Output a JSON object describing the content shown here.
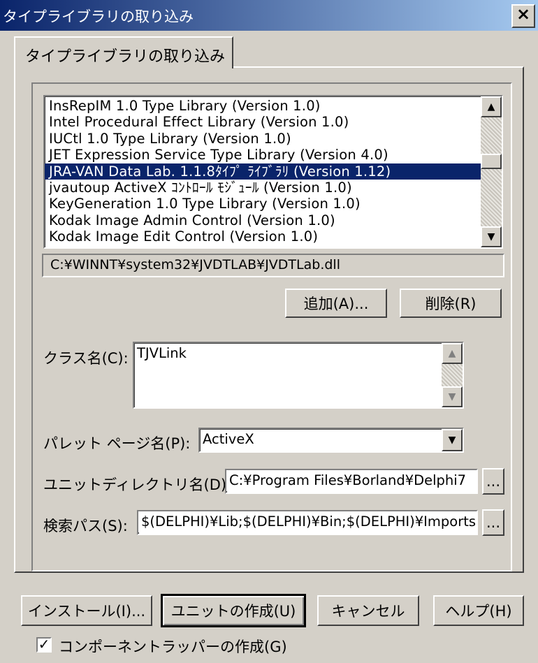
{
  "window": {
    "title": "タイプライブラリの取り込み",
    "close_glyph": "×"
  },
  "tab": {
    "label": "タイプライブラリの取り込み"
  },
  "library_list": {
    "items": [
      "InsRepIM 1.0 Type Library (Version 1.0)",
      "Intel Procedural Effect Library (Version 1.0)",
      "IUCtl 1.0 Type Library (Version 1.0)",
      "JET Expression Service Type Library (Version 4.0)",
      "JRA-VAN Data Lab. 1.1.8ﾀｲﾌﾟ ﾗｲﾌﾞﾗﾘ (Version 1.12)",
      "jvautoup ActiveX ｺﾝﾄﾛｰﾙ ﾓｼﾞｭｰﾙ (Version 1.0)",
      "KeyGeneration 1.0 Type Library (Version 1.0)",
      "Kodak Image Admin Control (Version 1.0)",
      "Kodak Image Edit Control (Version 1.0)"
    ],
    "selected_index": 4
  },
  "path": {
    "value": "C:¥WINNT¥system32¥JVDTLAB¥JVDTLab.dll"
  },
  "buttons": {
    "add": "追加(A)...",
    "remove": "削除(R)",
    "install": "インストール(I)...",
    "create_unit": "ユニットの作成(U)",
    "cancel": "キャンセル",
    "help": "ヘルプ(H)",
    "browse": "..."
  },
  "class_name": {
    "label": "クラス名(C):",
    "value": "TJVLink"
  },
  "palette_page": {
    "label": "パレット ページ名(P):",
    "value": "ActiveX"
  },
  "unit_dir": {
    "label": "ユニットディレクトリ名(D):",
    "value": "C:¥Program Files¥Borland¥Delphi7"
  },
  "search_path": {
    "label": "検索パス(S):",
    "value": "$(DELPHI)¥Lib;$(DELPHI)¥Bin;$(DELPHI)¥Imports"
  },
  "checkbox": {
    "label": "コンポーネントラッパーの作成(G)",
    "checked": true,
    "mark": "✓"
  }
}
